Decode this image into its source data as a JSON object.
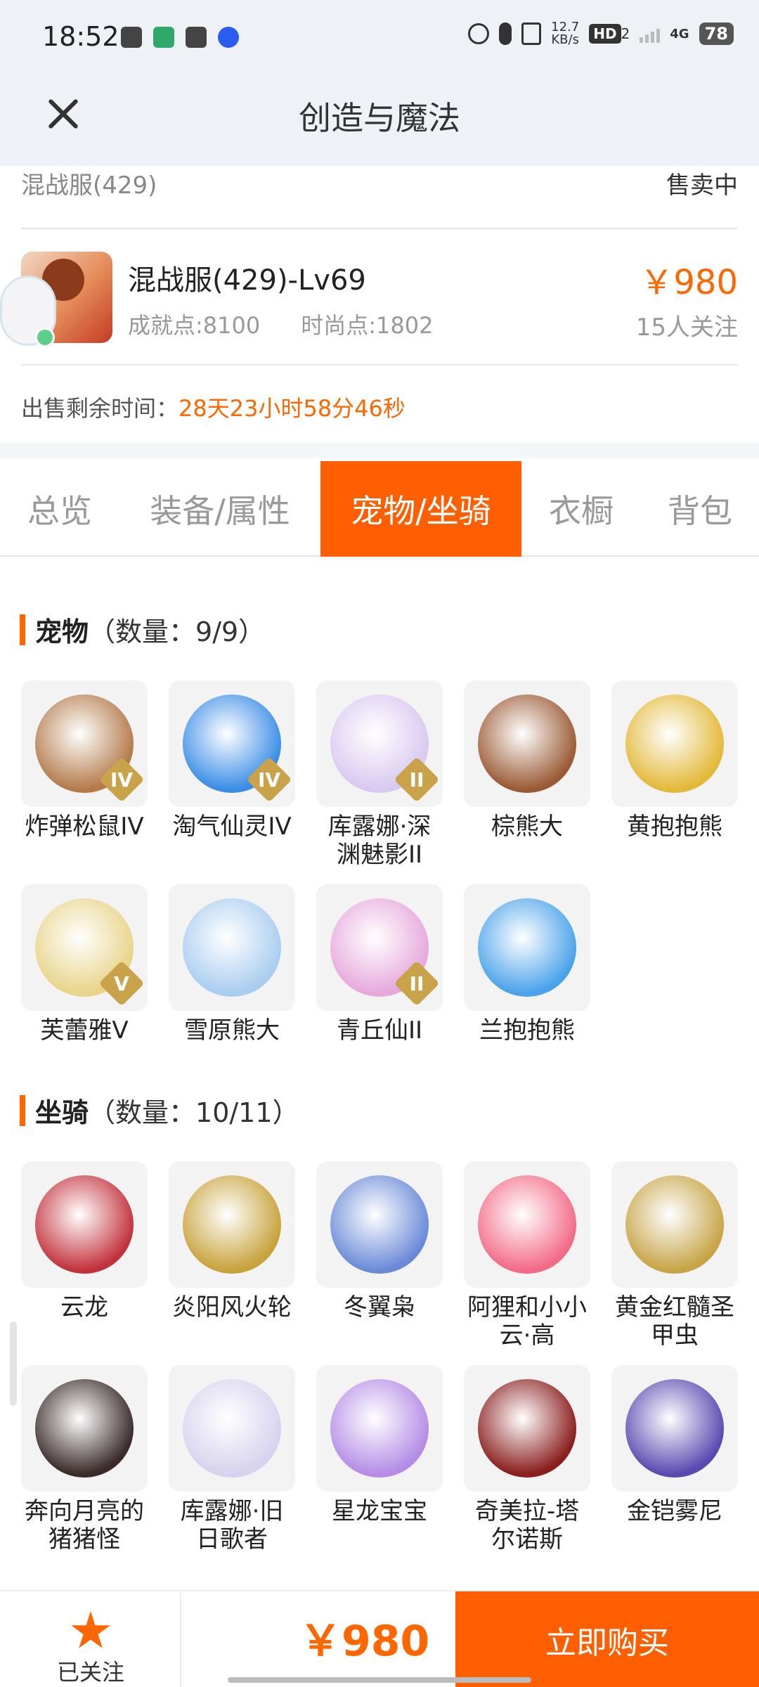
{
  "status_bar": {
    "time": "18:52",
    "net_speed_top": "12.7",
    "net_speed_unit": "KB/s",
    "hd_label": "HD",
    "hd_sub": "2",
    "network": "4G",
    "battery": "78"
  },
  "header": {
    "title": "创造与魔法"
  },
  "listing": {
    "server": "混战服(429)",
    "status": "售卖中",
    "character_name": "混战服(429)-Lv69",
    "achievement": "成就点:8100",
    "fashion": "时尚点:1802",
    "price": "￥980",
    "watchers": "15人关注",
    "remain_label": "出售剩余时间：",
    "remain_time": "28天23小时58分46秒"
  },
  "tabs": [
    {
      "label": "总览",
      "active": false
    },
    {
      "label": "装备/属性",
      "active": false
    },
    {
      "label": "宠物/坐骑",
      "active": true
    },
    {
      "label": "衣橱",
      "active": false
    },
    {
      "label": "背包",
      "active": false
    }
  ],
  "pets": {
    "title": "宠物",
    "count": "（数量：9/9）",
    "items": [
      {
        "name": "炸弹松鼠IV",
        "badge": "IV",
        "color": "#b47a4a"
      },
      {
        "name": "淘气仙灵IV",
        "badge": "IV",
        "color": "#3a8de6"
      },
      {
        "name": "库露娜·深渊魅影II",
        "badge": "II",
        "color": "#d9c8f0"
      },
      {
        "name": "棕熊大",
        "badge": "",
        "color": "#9a5a34"
      },
      {
        "name": "黄抱抱熊",
        "badge": "",
        "color": "#e3b938"
      },
      {
        "name": "芙蕾雅V",
        "badge": "V",
        "color": "#e8d48a"
      },
      {
        "name": "雪原熊大",
        "badge": "",
        "color": "#a9cdf0"
      },
      {
        "name": "青丘仙II",
        "badge": "II",
        "color": "#e7a8dc"
      },
      {
        "name": "兰抱抱熊",
        "badge": "",
        "color": "#4aa3ea"
      }
    ]
  },
  "mounts": {
    "title": "坐骑",
    "count": "（数量：10/11）",
    "items": [
      {
        "name": "云龙",
        "color": "#c2323c"
      },
      {
        "name": "炎阳风火轮",
        "color": "#c8a23a"
      },
      {
        "name": "冬翼枭",
        "color": "#6a8ad8"
      },
      {
        "name": "阿狸和小小云·高",
        "color": "#f26a86"
      },
      {
        "name": "黄金红髓圣甲虫",
        "color": "#c7a446"
      },
      {
        "name": "奔向月亮的猪猪怪",
        "color": "#3a2a2a"
      },
      {
        "name": "库露娜·旧日歌者",
        "color": "#d7d2ee"
      },
      {
        "name": "星龙宝宝",
        "color": "#b48ce6"
      },
      {
        "name": "奇美拉-塔尔诺斯",
        "color": "#8a1e1e"
      },
      {
        "name": "金铠雾尼",
        "color": "#5a4ab0"
      }
    ]
  },
  "bottom_bar": {
    "follow_label": "已关注",
    "price": "￥980",
    "buy_label": "立即购买"
  }
}
